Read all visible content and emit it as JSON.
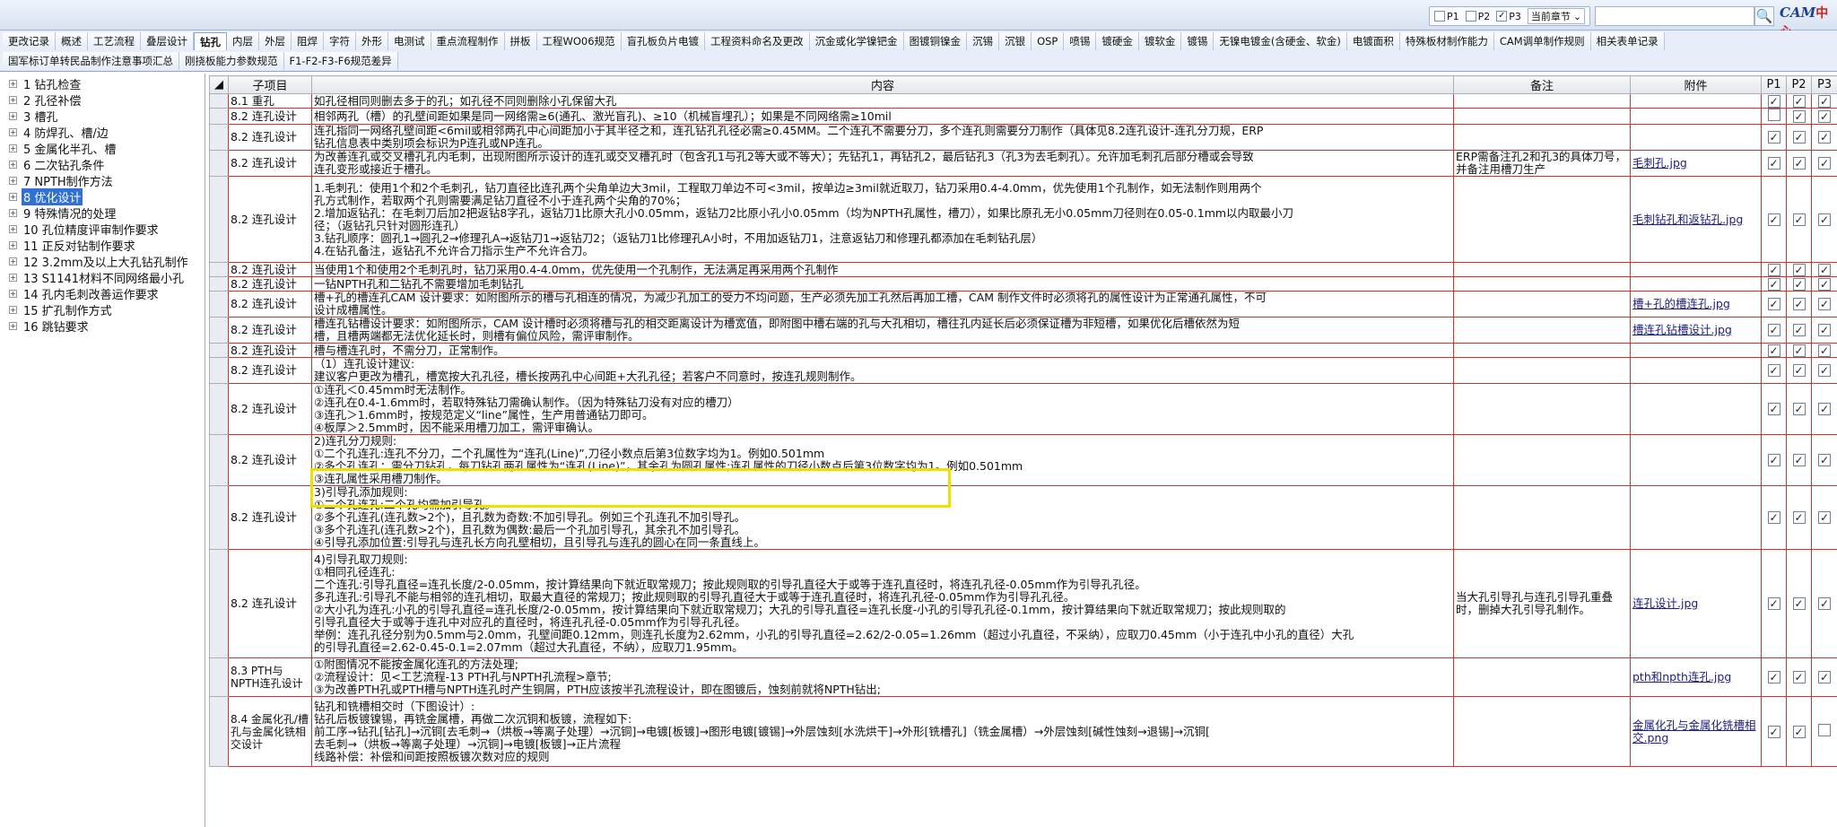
{
  "filters": {
    "p1": "P1",
    "p2": "P2",
    "p3": "P3",
    "p1_checked": false,
    "p2_checked": false,
    "p3_checked": true,
    "scope": "当前章节"
  },
  "search": {
    "placeholder": "",
    "value": ""
  },
  "logo": {
    "brand": "CAM",
    "suffix": "中心"
  },
  "tabs_row1": [
    "更改记录",
    "概述",
    "工艺流程",
    "叠层设计",
    "钻孔",
    "内层",
    "外层",
    "阻焊",
    "字符",
    "外形",
    "电测试",
    "重点流程制作",
    "拼板",
    "工程WO06规范",
    "盲孔板负片电镀",
    "工程资料命名及更改",
    "沉金或化学镍钯金",
    "图镀铜镍金",
    "沉锡",
    "沉银",
    "OSP",
    "喷锡",
    "镀硬金",
    "镀软金",
    "镀锡",
    "无镍电镀金(含硬金、软金)",
    "电镀面积",
    "特殊板材制作能力",
    "CAM调单制作规则",
    "相关表单记录"
  ],
  "tabs_row2": [
    "国军标订单转民品制作注意事项汇总",
    "刚挠板能力参数规范",
    "F1-F2-F3-F6规范差异"
  ],
  "active_tab": "钻孔",
  "tree": [
    "1 钻孔检查",
    "2 孔径补偿",
    "3 槽孔",
    "4 防焊孔、槽/边",
    "5 金属化半孔、槽",
    "6 二次钻孔条件",
    "7 NPTH制作方法",
    "8 优化设计",
    "9 特殊情况的处理",
    "10 孔位精度评审制作要求",
    "11 正反对钻制作要求",
    "12 3.2mm及以上大孔钻孔制作",
    "13 S1141材料不同网络最小孔",
    "14 孔内毛刺改善运作要求",
    "15 扩孔制作方式",
    "16 跳钻要求"
  ],
  "tree_selected": 7,
  "grid": {
    "headers": {
      "sub": "子项目",
      "content": "内容",
      "note": "备注",
      "attach": "附件",
      "p1": "P1",
      "p2": "P2",
      "p3": "P3"
    },
    "rows": [
      {
        "sub": "8.1 重孔",
        "content": [
          "如孔径相同则删去多于的孔；如孔径不同则删除小孔保留大孔"
        ],
        "note": "",
        "attach": "",
        "p": [
          true,
          true,
          true
        ]
      },
      {
        "sub": "8.2 连孔设计",
        "content": [
          "相邻两孔（槽）的孔壁间距如果是同一网络需≥6(通孔、激光盲孔)、≥10（机械盲埋孔）；如果是不同网络需≥10mil"
        ],
        "note": "",
        "attach": "",
        "p": [
          false,
          true,
          true
        ]
      },
      {
        "sub": "8.2 连孔设计",
        "content": [
          "连孔指同一网络孔壁间距<6mil或相邻两孔中心间距加小于其半径之和，连孔钻孔孔径必需≥0.45MM。二个连孔不需要分刀，多个连孔则需要分刀制作（具体见8.2连孔设计-连孔分刀规，ERP",
          "钻孔信息表中类别项会标识为P连孔或NP连孔。"
        ],
        "note": "",
        "attach": "",
        "p": [
          true,
          true,
          true
        ]
      },
      {
        "sub": "8.2 连孔设计",
        "content": [
          "为改善连孔或交叉槽孔孔内毛刺，出现附图所示设计的连孔或交叉槽孔时（包含孔1与孔2等大或不等大）；先钻孔1，再钻孔2，最后钻孔3（孔3为去毛刺孔）。允许加毛刺孔后部分槽或会导致",
          "连孔变形或接近于槽孔。"
        ],
        "note": "ERP需备注孔2和孔3的具体刀号，并备注用槽刀生产",
        "attach": "毛刺孔.jpg",
        "p": [
          true,
          true,
          true
        ]
      },
      {
        "sub": "8.2 连孔设计",
        "content": [
          "1.毛刺孔：使用1个和2个毛刺孔，钻刀直径比连孔两个尖角单边大3mil，工程取刀单边不可<3mil，按单边≥3mil就近取刀，钻刀采用0.4-4.0mm，优先使用1个孔制作，如无法制作则用两个",
          "孔方式制作，若取两个孔则需要满足钻刀直径不小于连孔两个尖角的70%；",
          "2.增加返钻孔：在毛刺刀后加2把返钻8字孔，返钻刀1比原大孔小0.05mm，返钻刀2比原小孔小0.05mm（均为NPTH孔属性，槽刀），如果比原孔无小0.05mm刀径则在0.05-0.1mm以内取最小刀",
          "径；（返钻孔只针对圆形连孔）",
          "3.钻孔顺序：圆孔1→圆孔2→修理孔A→返钻刀1→返钻刀2；（返钻刀1比修理孔A小时，不用加返钻刀1，注意返钻刀和修理孔都添加在毛刺钻孔层）",
          "4.在钻孔备注，返钻孔不允许合刀指示生产不允许合刀。"
        ],
        "note": "",
        "attach": "毛刺钻孔和返钻孔.jpg",
        "p": [
          true,
          true,
          true
        ]
      },
      {
        "sub": "8.2 连孔设计",
        "content": [
          "当使用1个和使用2个毛刺孔时，钻刀采用0.4-4.0mm，优先使用一个孔制作，无法满足再采用两个孔制作"
        ],
        "note": "",
        "attach": "",
        "p": [
          true,
          true,
          true
        ]
      },
      {
        "sub": "8.2 连孔设计",
        "content": [
          "一钻NPTH孔和二钻孔不需要增加毛刺钻孔"
        ],
        "note": "",
        "attach": "",
        "p": [
          true,
          true,
          true
        ]
      },
      {
        "sub": "8.2 连孔设计",
        "content": [
          "槽+孔的槽连孔CAM 设计要求：如附图所示的槽与孔相连的情况，为减少孔加工的受力不均问题，生产必须先加工孔然后再加工槽，CAM 制作文件时必须将孔的属性设计为正常通孔属性，不可",
          "设计成槽属性。"
        ],
        "note": "",
        "attach": "槽+孔的槽连孔.jpg",
        "p": [
          true,
          true,
          true
        ]
      },
      {
        "sub": "8.2 连孔设计",
        "content": [
          "槽连孔钻槽设计要求：如附图所示，CAM 设计槽时必须将槽与孔的相交距离设计为槽宽值，即附图中槽右端的孔与大孔相切，槽往孔内延长后必须保证槽为非短槽，如果优化后槽依然为短",
          "槽，且槽两端都无法优化延长时，则槽有偏位风险，需评审制作。"
        ],
        "note": "",
        "attach": "槽连孔钻槽设计.jpg",
        "p": [
          true,
          true,
          true
        ]
      },
      {
        "sub": "8.2 连孔设计",
        "content": [
          "槽与槽连孔时，不需分刀，正常制作。"
        ],
        "note": "",
        "attach": "",
        "p": [
          true,
          true,
          true
        ]
      },
      {
        "sub": "8.2 连孔设计",
        "content": [
          "（1）连孔设计建议:",
          "建议客户更改为槽孔，槽宽按大孔孔径，槽长按两孔中心间距+大孔孔径；若客户不同意时，按连孔规则制作。"
        ],
        "note": "",
        "attach": "",
        "p": [
          true,
          true,
          true
        ]
      },
      {
        "sub": "8.2 连孔设计",
        "content": [
          "①连孔＜0.45mm时无法制作。",
          "②连孔在0.4-1.6mm时，若取特殊钻刀需确认制作。（因为特殊钻刀没有对应的槽刀）",
          "③连孔＞1.6mm时，按规范定义“line”属性，生产用普通钻刀即可。",
          "④板厚＞2.5mm时，因不能采用槽刀加工，需评审确认。"
        ],
        "note": "",
        "attach": "",
        "p": [
          true,
          true,
          true
        ]
      },
      {
        "sub": "8.2 连孔设计",
        "content": [
          "2)连孔分刀规则:",
          "①二个孔连孔:连孔不分刀，二个孔属性为“连孔(Line)”,刀径小数点后第3位数字均为1。例如0.501mm",
          "②多个孔连孔：需分刀钻孔，每刀钻孔两孔属性为“连孔(Line)”，其余孔为圆孔属性;连孔属性的刀径小数点后第3位数字均为1。例如0.501mm",
          "③连孔属性采用槽刀制作。"
        ],
        "note": "",
        "attach": "",
        "p": [
          true,
          true,
          true
        ]
      },
      {
        "sub": "8.2 连孔设计",
        "content": [
          "3)引导孔添加规则:",
          "①二个孔连孔:二个孔均需加引导孔。",
          "②多个孔连孔(连孔数>2个)，且孔数为奇数:不加引导孔。例如三个孔连孔不加引导孔。",
          "③多个孔连孔(连孔数>2个)，且孔数为偶数:最后一个孔加引导孔，其余孔不加引导孔。",
          "④引导孔添加位置:引导孔与连孔长方向孔壁相切，且引导孔与连孔的圆心在同一条直线上。"
        ],
        "note": "",
        "attach": "",
        "p": [
          true,
          true,
          true
        ]
      },
      {
        "sub": "8.2 连孔设计",
        "content": [
          "4)引导孔取刀规则:",
          "①相同孔径连孔:",
          "二个连孔:引导孔直径=连孔长度/2-0.05mm，按计算结果向下就近取常规刀；按此规则取的引导孔直径大于或等于连孔直径时，将连孔孔径-0.05mm作为引导孔孔径。",
          "多孔连孔:引导孔不能与相邻的连孔相切，取最大直径的常规刀；按此规则取的引导孔直径大于或等于连孔直径时，将连孔孔径-0.05mm作为引导孔孔径。",
          "②大小孔为连孔:小孔的引导孔直径=连孔长度/2-0.05mm，按计算结果向下就近取常规刀；大孔的引导孔直径=连孔长度-小孔的引导孔孔径-0.1mm，按计算结果向下就近取常规刀；按此规则取的",
          "引导孔直径大于或等于连孔中对应孔的直径时，将连孔孔径-0.05mm作为引导孔孔径。",
          "举例：连孔孔径分别为0.5mm与2.0mm，孔壁间距0.12mm，则连孔长度为2.62mm，小孔的引导孔直径=2.62/2-0.05=1.26mm（超过小孔直径，不采纳），应取刀0.45mm（小于连孔中小孔的直径）大孔",
          "的引导孔直径=2.62-0.45-0.1=2.07mm（超过大孔直径，不纳），应取刀1.95mm。"
        ],
        "note": "当大孔引导孔与连孔引导孔重叠时，删掉大孔引导孔制作。",
        "attach": "连孔设计.jpg",
        "p": [
          true,
          true,
          true
        ]
      },
      {
        "sub": "8.3 PTH与NPTH连孔设计",
        "content": [
          "①附图情况不能按金属化连孔的方法处理;",
          "②流程设计：见<工艺流程-13 PTH孔与NPTH孔流程>章节;",
          "③为改善PTH孔或PTH槽与NPTH连孔时产生铜屑，PTH应该按半孔流程设计，即在图镀后，蚀刻前就将NPTH钻出;"
        ],
        "note": "",
        "attach": "pth和npth连孔.jpg",
        "p": [
          true,
          true,
          true
        ]
      },
      {
        "sub": "8.4 金属化孔/槽孔与金属化铣相交设计",
        "content": [
          "钻孔和铣槽相交时（下图设计）:",
          "钻孔后板镀镍锡，再铣金属槽，再做二次沉铜和板镀，流程如下:",
          "前工序→钻孔[钻孔]→沉铜[去毛刺→（烘板→等离子处理）→沉铜]→电镀[板镀]→图形电镀[镀锡]→外层蚀刻[水洗烘干]→外形[铣槽孔]（铣金属槽）→外层蚀刻[碱性蚀刻→退锡]→沉铜[",
          "去毛刺→（烘板→等离子处理）→沉铜]→电镀[板镀]→正片流程",
          "线路补偿：补偿和间距按照板镀次数对应的规则"
        ],
        "note": "",
        "attach": "金属化孔与金属化铣槽相交.png",
        "p": [
          true,
          true,
          false
        ]
      }
    ]
  }
}
